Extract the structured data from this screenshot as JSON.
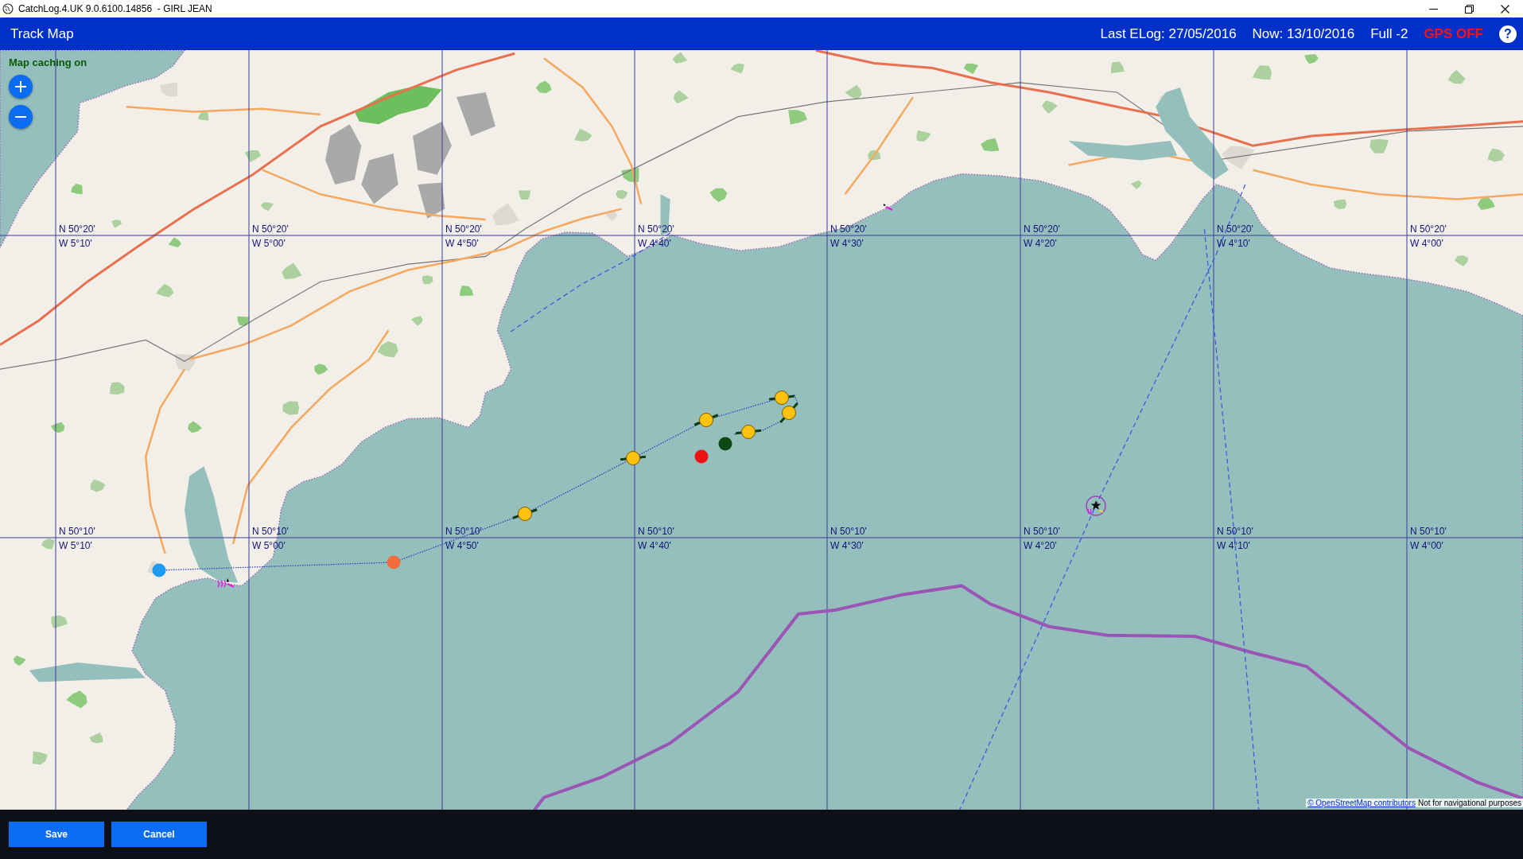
{
  "window": {
    "title": "CatchLog.4.UK 9.0.6100.14856  - GIRL JEAN"
  },
  "header": {
    "title": "Track Map",
    "last_elog": "Last ELog: 27/05/2016",
    "now": "Now: 13/10/2016",
    "zoom_level": "Full -2",
    "gps": {
      "label": "GPS OFF",
      "on": false
    },
    "help": "?"
  },
  "map": {
    "caching": "Map caching on",
    "grid": [
      {
        "labels": [
          {
            "lat": "N 50°20'",
            "lon": "W 5°10'"
          },
          {
            "lat": "N 50°20'",
            "lon": "W 5°00'"
          },
          {
            "lat": "N 50°20'",
            "lon": "W 4°50'"
          },
          {
            "lat": "N 50°20'",
            "lon": "W 4°40'"
          },
          {
            "lat": "N 50°20'",
            "lon": "W 4°30'"
          },
          {
            "lat": "N 50°20'",
            "lon": "W 4°20'"
          },
          {
            "lat": "N 50°20'",
            "lon": "W 4°10'"
          },
          {
            "lat": "N 50°20'",
            "lon": "W 4°00'"
          }
        ]
      },
      {
        "labels": [
          {
            "lat": "N 50°10'",
            "lon": "W 5°10'"
          },
          {
            "lat": "N 50°10'",
            "lon": "W 5°00'"
          },
          {
            "lat": "N 50°10'",
            "lon": "W 4°50'"
          },
          {
            "lat": "N 50°10'",
            "lon": "W 4°40'"
          },
          {
            "lat": "N 50°10'",
            "lon": "W 4°30'"
          },
          {
            "lat": "N 50°10'",
            "lon": "W 4°20'"
          },
          {
            "lat": "N 50°10'",
            "lon": "W 4°10'"
          },
          {
            "lat": "N 50°10'",
            "lon": "W 4°00'"
          }
        ]
      }
    ],
    "track": [
      {
        "kind": "dot",
        "color": "#1e9bf0"
      },
      {
        "kind": "dot",
        "color": "#f26d3d"
      },
      {
        "kind": "ticked",
        "color": "#ffc20e"
      },
      {
        "kind": "ticked",
        "color": "#ffc20e"
      },
      {
        "kind": "ticked",
        "color": "#ffc20e"
      },
      {
        "kind": "ticked",
        "color": "#ffc20e"
      },
      {
        "kind": "ticked",
        "color": "#ffc20e"
      },
      {
        "kind": "ticked",
        "color": "#ffc20e"
      },
      {
        "kind": "dot",
        "color": "#ee1111"
      },
      {
        "kind": "dot",
        "color": "#0b4a12"
      }
    ],
    "attribution": {
      "link": "© OpenStreetMap contributors",
      "note": "Not for navigational purposes"
    }
  },
  "buttons": [
    {
      "label": "Save"
    },
    {
      "label": "Cancel"
    }
  ]
}
